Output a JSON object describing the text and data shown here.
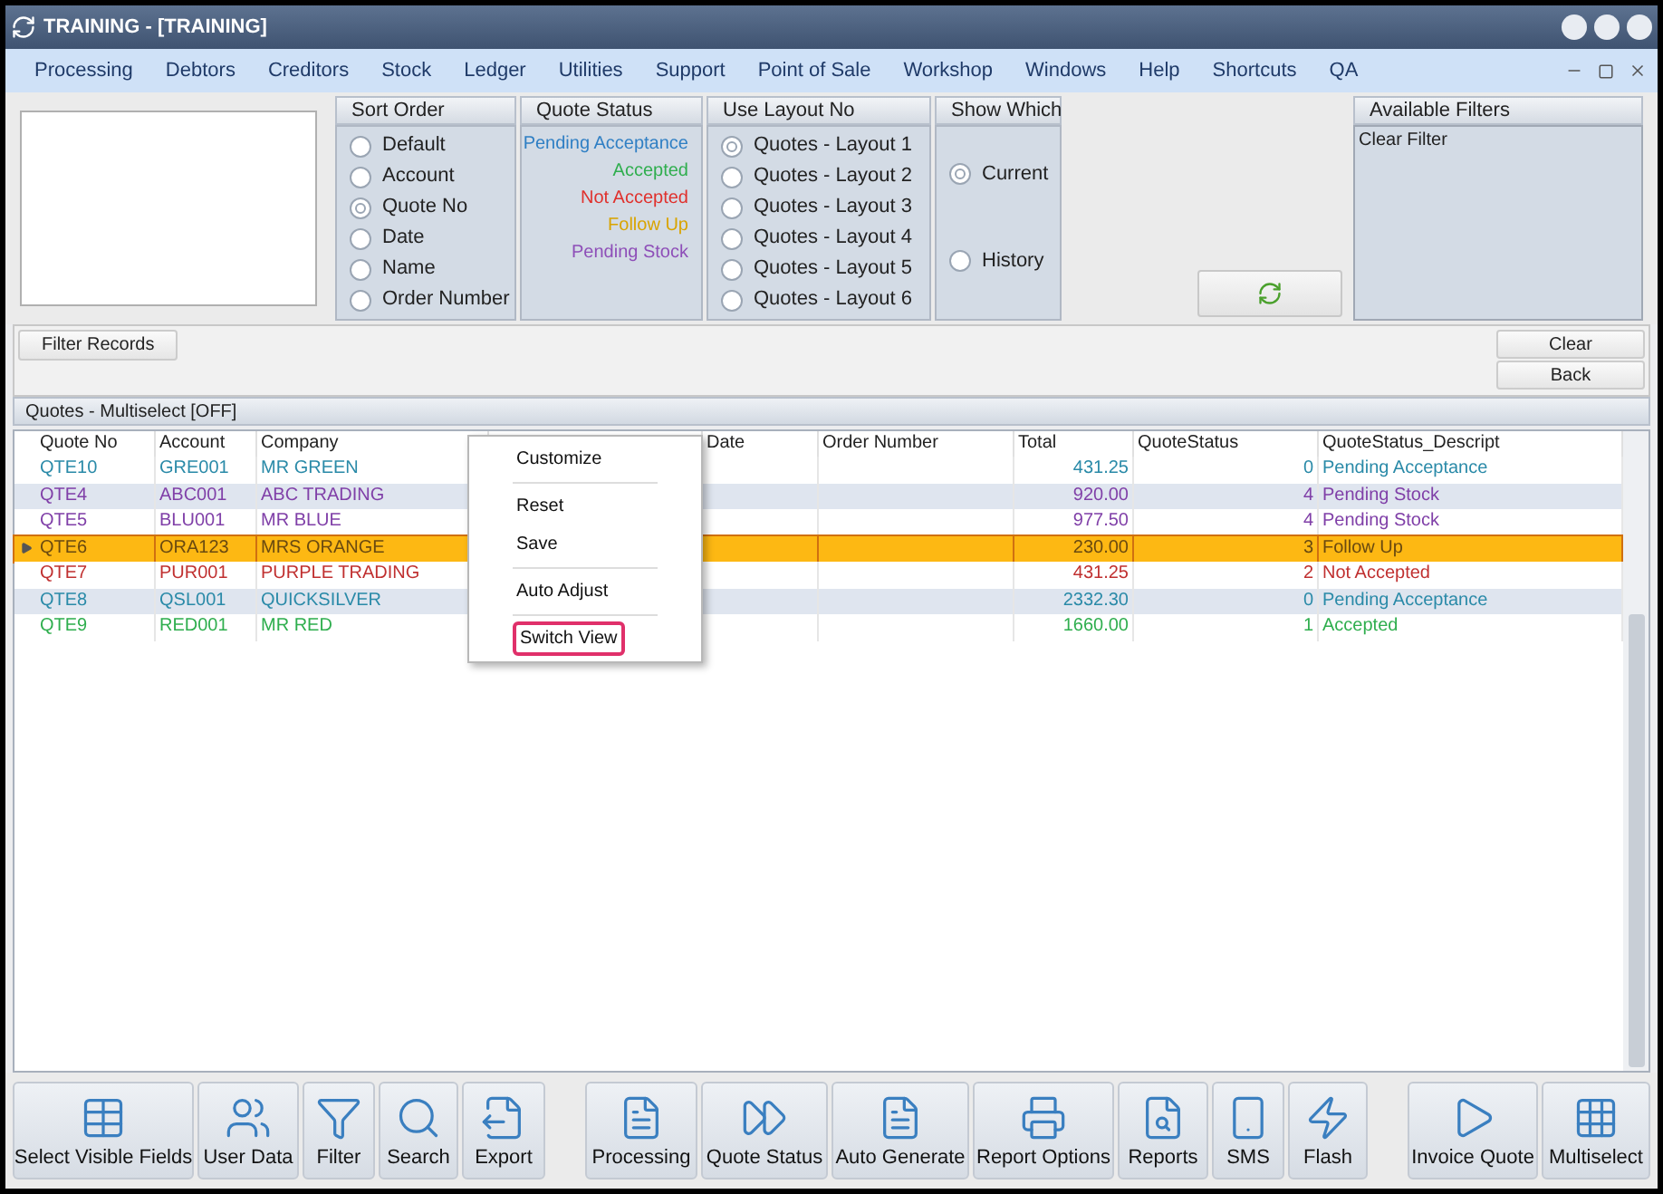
{
  "window": {
    "title": "TRAINING - [TRAINING]"
  },
  "menu": [
    "Processing",
    "Debtors",
    "Creditors",
    "Stock",
    "Ledger",
    "Utilities",
    "Support",
    "Point of Sale",
    "Workshop",
    "Windows",
    "Help",
    "Shortcuts",
    "QA"
  ],
  "sort_order": {
    "title": "Sort Order",
    "options": [
      {
        "label": "Default",
        "selected": false
      },
      {
        "label": "Account",
        "selected": false
      },
      {
        "label": "Quote No",
        "selected": true
      },
      {
        "label": "Date",
        "selected": false
      },
      {
        "label": "Name",
        "selected": false
      },
      {
        "label": "Order Number",
        "selected": false
      }
    ]
  },
  "quote_status": {
    "title": "Quote Status",
    "items": [
      {
        "label": "Pending Acceptance",
        "color": "#2f7fc4"
      },
      {
        "label": "Accepted",
        "color": "#2fae4e"
      },
      {
        "label": "Not Accepted",
        "color": "#e0302c"
      },
      {
        "label": "Follow Up",
        "color": "#d9a400"
      },
      {
        "label": "Pending Stock",
        "color": "#8e4fb8"
      }
    ]
  },
  "layout_no": {
    "title": "Use Layout No",
    "options": [
      {
        "label": "Quotes - Layout 1",
        "selected": true
      },
      {
        "label": "Quotes - Layout 2",
        "selected": false
      },
      {
        "label": "Quotes - Layout 3",
        "selected": false
      },
      {
        "label": "Quotes - Layout 4",
        "selected": false
      },
      {
        "label": "Quotes - Layout 5",
        "selected": false
      },
      {
        "label": "Quotes - Layout 6",
        "selected": false
      }
    ]
  },
  "show_which": {
    "title": "Show Which",
    "options": [
      {
        "label": "Current",
        "selected": true
      },
      {
        "label": "History",
        "selected": false
      }
    ]
  },
  "available_filters": {
    "title": "Available Filters",
    "items": [
      "Clear Filter"
    ]
  },
  "filter_bar": {
    "filter_button": "Filter Records",
    "clear_button": "Clear",
    "back_button": "Back"
  },
  "grid": {
    "title": "Quotes - Multiselect [OFF]",
    "columns": [
      "Quote No",
      "Account",
      "Company",
      "",
      "Date",
      "Order Number",
      "Total",
      "QuoteStatus",
      "QuoteStatus_Descript"
    ],
    "rows": [
      {
        "cells": [
          "QTE10",
          "GRE001",
          "MR GREEN",
          "",
          "",
          "",
          "431.25",
          "0",
          "Pending Acceptance"
        ],
        "color": "#2a8aa8",
        "selected": false
      },
      {
        "cells": [
          "QTE4",
          "ABC001",
          "ABC TRADING",
          "",
          "",
          "",
          "920.00",
          "4",
          "Pending Stock"
        ],
        "color": "#8040a8",
        "selected": false
      },
      {
        "cells": [
          "QTE5",
          "BLU001",
          "MR BLUE",
          "",
          "",
          "",
          "977.50",
          "4",
          "Pending Stock"
        ],
        "color": "#8040a8",
        "selected": false
      },
      {
        "cells": [
          "QTE6",
          "ORA123",
          "MRS ORANGE",
          "",
          "",
          "",
          "230.00",
          "3",
          "Follow Up"
        ],
        "color": "#6a4a10",
        "selected": true
      },
      {
        "cells": [
          "QTE7",
          "PUR001",
          "PURPLE TRADING",
          "",
          "",
          "",
          "431.25",
          "2",
          "Not Accepted"
        ],
        "color": "#c03030",
        "selected": false
      },
      {
        "cells": [
          "QTE8",
          "QSL001",
          "QUICKSILVER",
          "",
          "",
          "",
          "2332.30",
          "0",
          "Pending Acceptance"
        ],
        "color": "#2a8aa8",
        "selected": false
      },
      {
        "cells": [
          "QTE9",
          "RED001",
          "MR RED",
          "",
          "",
          "",
          "1660.00",
          "1",
          "Accepted"
        ],
        "color": "#2fae4e",
        "selected": false
      }
    ]
  },
  "context_menu": [
    {
      "label": "Customize",
      "highlighted": false
    },
    {
      "label": "Reset",
      "highlighted": false
    },
    {
      "label": "Save",
      "highlighted": false
    },
    {
      "label": "Auto Adjust",
      "highlighted": false
    },
    {
      "label": "Switch View",
      "highlighted": true
    }
  ],
  "toolbar": {
    "left": [
      "Select Visible Fields",
      "User Data",
      "Filter",
      "Search",
      "Export"
    ],
    "middle": [
      "Processing",
      "Quote Status",
      "Auto Generate",
      "Report Options",
      "Reports",
      "SMS",
      "Flash"
    ],
    "right": [
      "Invoice Quote",
      "Multiselect"
    ]
  }
}
